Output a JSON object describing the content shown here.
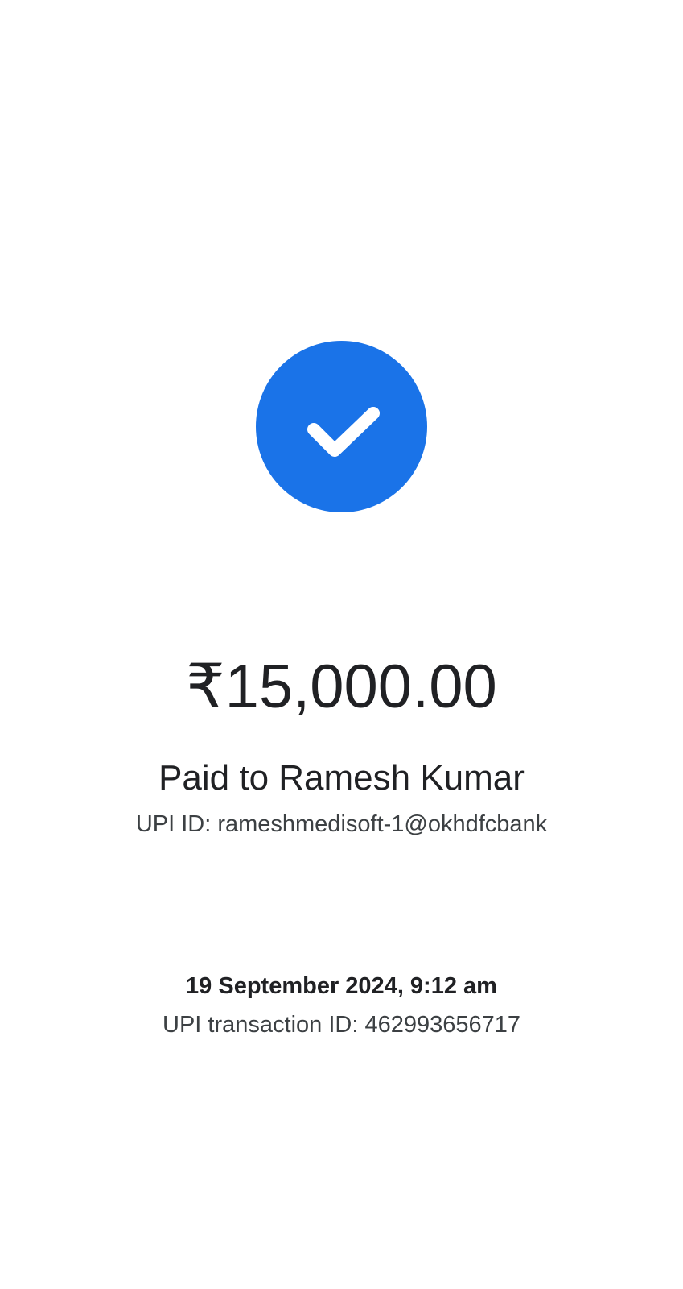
{
  "status": {
    "icon": "check-circle-icon",
    "color": "#1a73e8"
  },
  "payment": {
    "amount": "₹15,000.00",
    "payee_line": "Paid to Ramesh Kumar",
    "upi_id_line": "UPI ID: rameshmedisoft-1@okhdfcbank"
  },
  "transaction": {
    "datetime": "19 September 2024, 9:12 am",
    "txn_id_line": "UPI transaction ID: 462993656717"
  }
}
